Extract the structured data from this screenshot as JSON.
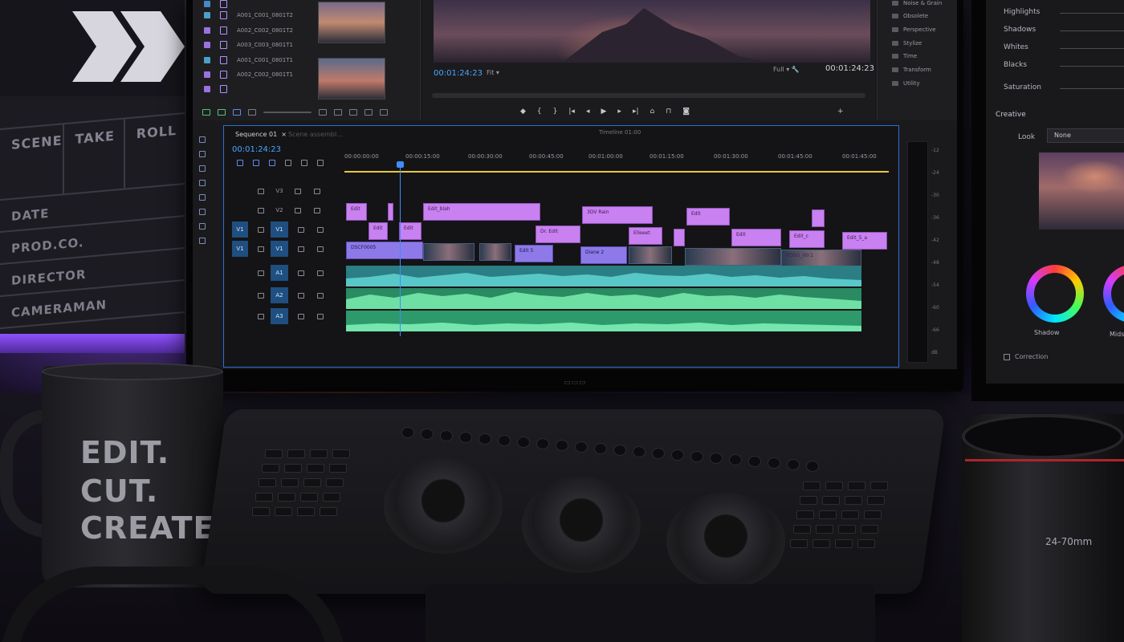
{
  "project": {
    "items": [
      {
        "name": "",
        "color": "#4a87c8"
      },
      {
        "name": "A001_C001_0801T2",
        "color": "#8ab8ff"
      },
      {
        "name": "A002_C002_0801T2",
        "color": "#b58af0"
      },
      {
        "name": "A003_C003_0801T1",
        "color": "#b58af0"
      },
      {
        "name": "A001_C001_0801T1",
        "color": "#4aa0c8"
      },
      {
        "name": "A002_C002_0801T1",
        "color": "#b58af0"
      }
    ]
  },
  "program": {
    "timecode": "00:01:24:23",
    "fit": "Fit",
    "quality": "Full",
    "timecode_right": "00:01:24:23"
  },
  "effects": {
    "items": [
      "Noise & Grain",
      "Obsolete",
      "Perspective",
      "Stylize",
      "Time",
      "Transform",
      "Utility"
    ]
  },
  "timeline": {
    "tab": "Sequence 01",
    "tab_close": "×",
    "tab2": "Scene assembl...",
    "mid_label": "Timeline 01:00",
    "timecode": "00:01:24:23",
    "ruler": [
      "00:00:00:00",
      "00:00:15:00",
      "00:00:30:00",
      "00:00:45:00",
      "00:01:00:00",
      "00:01:15:00",
      "00:01:30:00",
      "00:01:45:00",
      "00:01:45:00"
    ],
    "tracks": [
      {
        "toggle": "",
        "label": "V3"
      },
      {
        "toggle": "",
        "label": "V2"
      },
      {
        "toggle": "V1",
        "label": "V1"
      },
      {
        "toggle": "V1",
        "label": "V1"
      },
      {
        "toggle": "",
        "label": "A1"
      },
      {
        "toggle": "",
        "label": "A2"
      },
      {
        "toggle": "",
        "label": "A3"
      }
    ],
    "clips_v3": [
      "Edit",
      "",
      "Edit_blah",
      "3DV Rain",
      "Edit",
      ""
    ],
    "clips_v2": [
      "Edit",
      "Edit",
      "Dr. Edit",
      "Elleeet",
      "",
      "Edit",
      "Edit_c",
      "Edit_5_a"
    ],
    "clips_v1": [
      "DSCF0005",
      "Edit 5",
      "Diane 2",
      "ROSO_00:1"
    ],
    "meter_labels": [
      "-12",
      "-24",
      "-30",
      "-36",
      "-42",
      "-48",
      "-54",
      "-60",
      "-66",
      "dB"
    ]
  },
  "color_panel": {
    "sliders": [
      "Highlights",
      "Shadows",
      "Whites",
      "Blacks",
      "Saturation"
    ],
    "creative": "Creative",
    "look_label": "Look",
    "look_value": "None",
    "wheel_shadow": "Shadow",
    "wheel_mids": "Mids",
    "checkbox": "Correction"
  },
  "mug": {
    "line1": "EDIT.",
    "line2": "CUT.",
    "line3": "CREATE."
  },
  "clapper": {
    "headers": [
      "SCENE",
      "TAKE",
      "ROLL"
    ],
    "rows": [
      "DATE",
      "PROD.CO.",
      "DIRECTOR",
      "CAMERAMAN"
    ]
  },
  "lens": {
    "focal": "24-70mm"
  }
}
